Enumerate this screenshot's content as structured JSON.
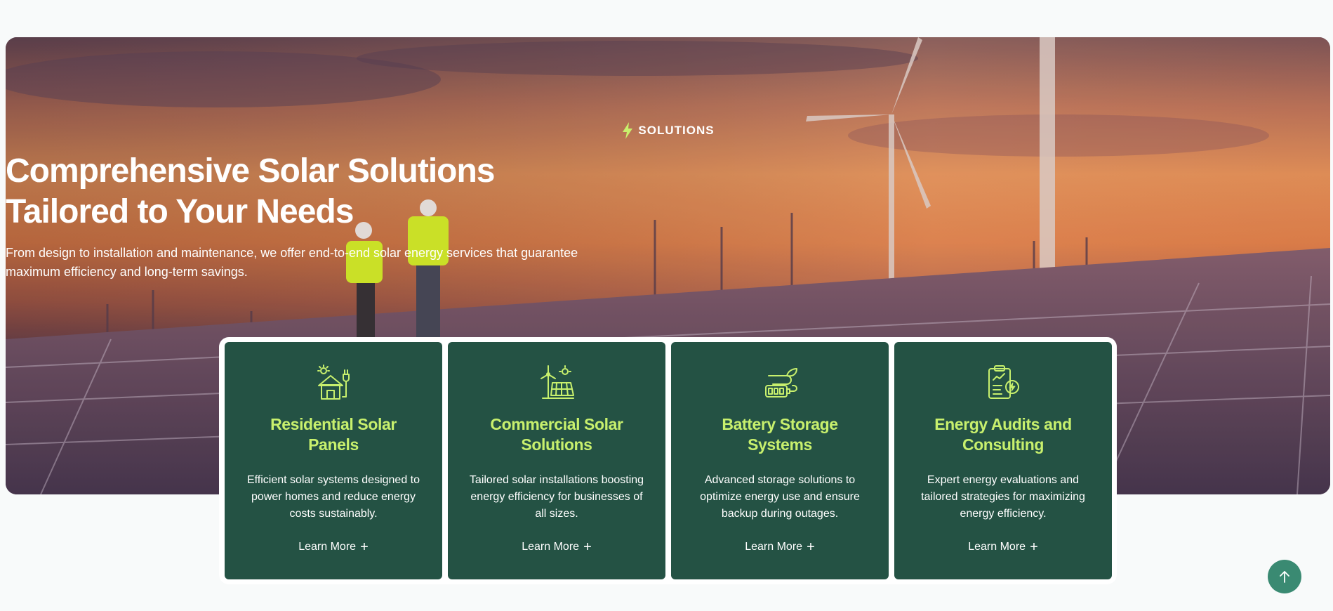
{
  "hero": {
    "tag_icon": "lightning-bolt-icon",
    "tag": "SOLUTIONS",
    "title_line1": "Comprehensive Solar Solutions",
    "title_line2": "Tailored to Your Needs",
    "subtitle_line1": "From design to installation and maintenance, we offer end-to-end solar energy services that guarantee",
    "subtitle_line2": "maximum efficiency and long-term savings.",
    "accent_color": "#c8f06d"
  },
  "cards": [
    {
      "icon": "solar-house-icon",
      "title_line1": "Residential Solar",
      "title_line2": "Panels",
      "desc_line1": "Efficient solar systems designed to",
      "desc_line2": "power homes and reduce energy",
      "desc_line3": "costs sustainably.",
      "link": "Learn More"
    },
    {
      "icon": "wind-solar-panel-icon",
      "title_line1": "Commercial Solar",
      "title_line2": "Solutions",
      "desc_line1": "Tailored solar installations boosting",
      "desc_line2": "energy efficiency for businesses of",
      "desc_line3": "all sizes.",
      "link": "Learn More"
    },
    {
      "icon": "battery-leaf-icon",
      "title_line1": "Battery Storage",
      "title_line2": "Systems",
      "desc_line1": "Advanced storage solutions to",
      "desc_line2": "optimize energy use and ensure",
      "desc_line3": "backup during outages.",
      "link": "Learn More"
    },
    {
      "icon": "clipboard-chart-icon",
      "title_line1": "Energy Audits and",
      "title_line2": "Consulting",
      "desc_line1": "Expert energy evaluations and",
      "desc_line2": "tailored strategies for maximizing",
      "desc_line3": "energy efficiency.",
      "link": "Learn More"
    }
  ],
  "scroll_top": {
    "icon": "arrow-up-icon",
    "color": "#3a8a72"
  },
  "colors": {
    "card_bg": "#245244",
    "title": "#c8f06d",
    "page_bg": "#f8fafa"
  }
}
